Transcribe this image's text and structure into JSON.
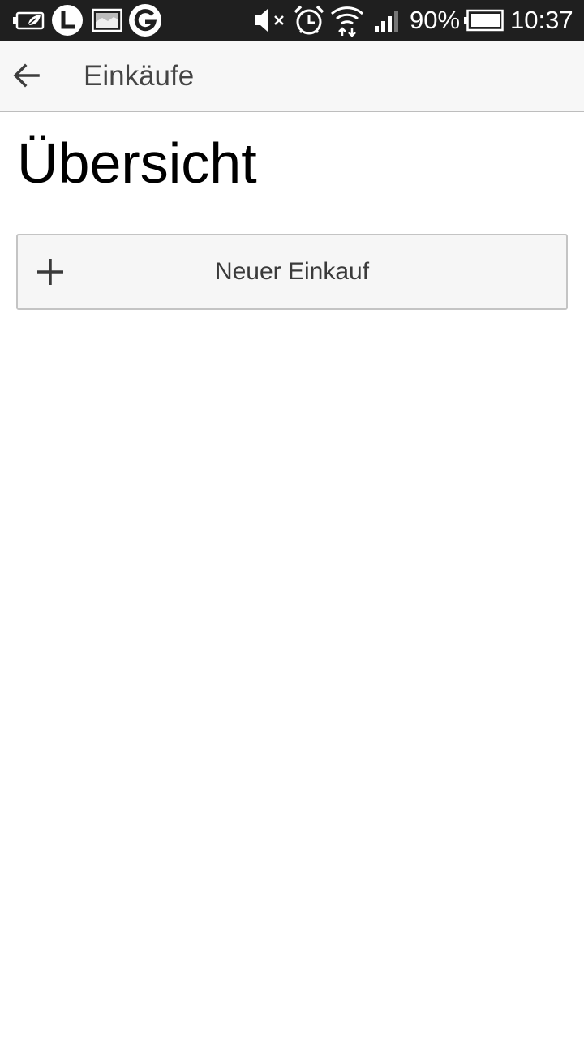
{
  "status_bar": {
    "battery_percent": "90%",
    "time": "10:37",
    "icons": [
      "battery-saver-icon",
      "clock-app-icon",
      "gallery-icon",
      "google-icon",
      "mute-icon",
      "alarm-icon",
      "wifi-icon",
      "signal-icon",
      "battery-icon"
    ]
  },
  "app_bar": {
    "title": "Einkäufe",
    "back_icon": "arrow-left-icon"
  },
  "main": {
    "page_title": "Übersicht",
    "new_purchase_button": {
      "label": "Neuer Einkauf",
      "icon": "plus-icon"
    }
  },
  "colors": {
    "status_bar_bg": "#1f1f1f",
    "app_bar_bg": "#f7f7f7",
    "button_bg": "#f6f6f6",
    "button_border": "#c4c4c4"
  }
}
